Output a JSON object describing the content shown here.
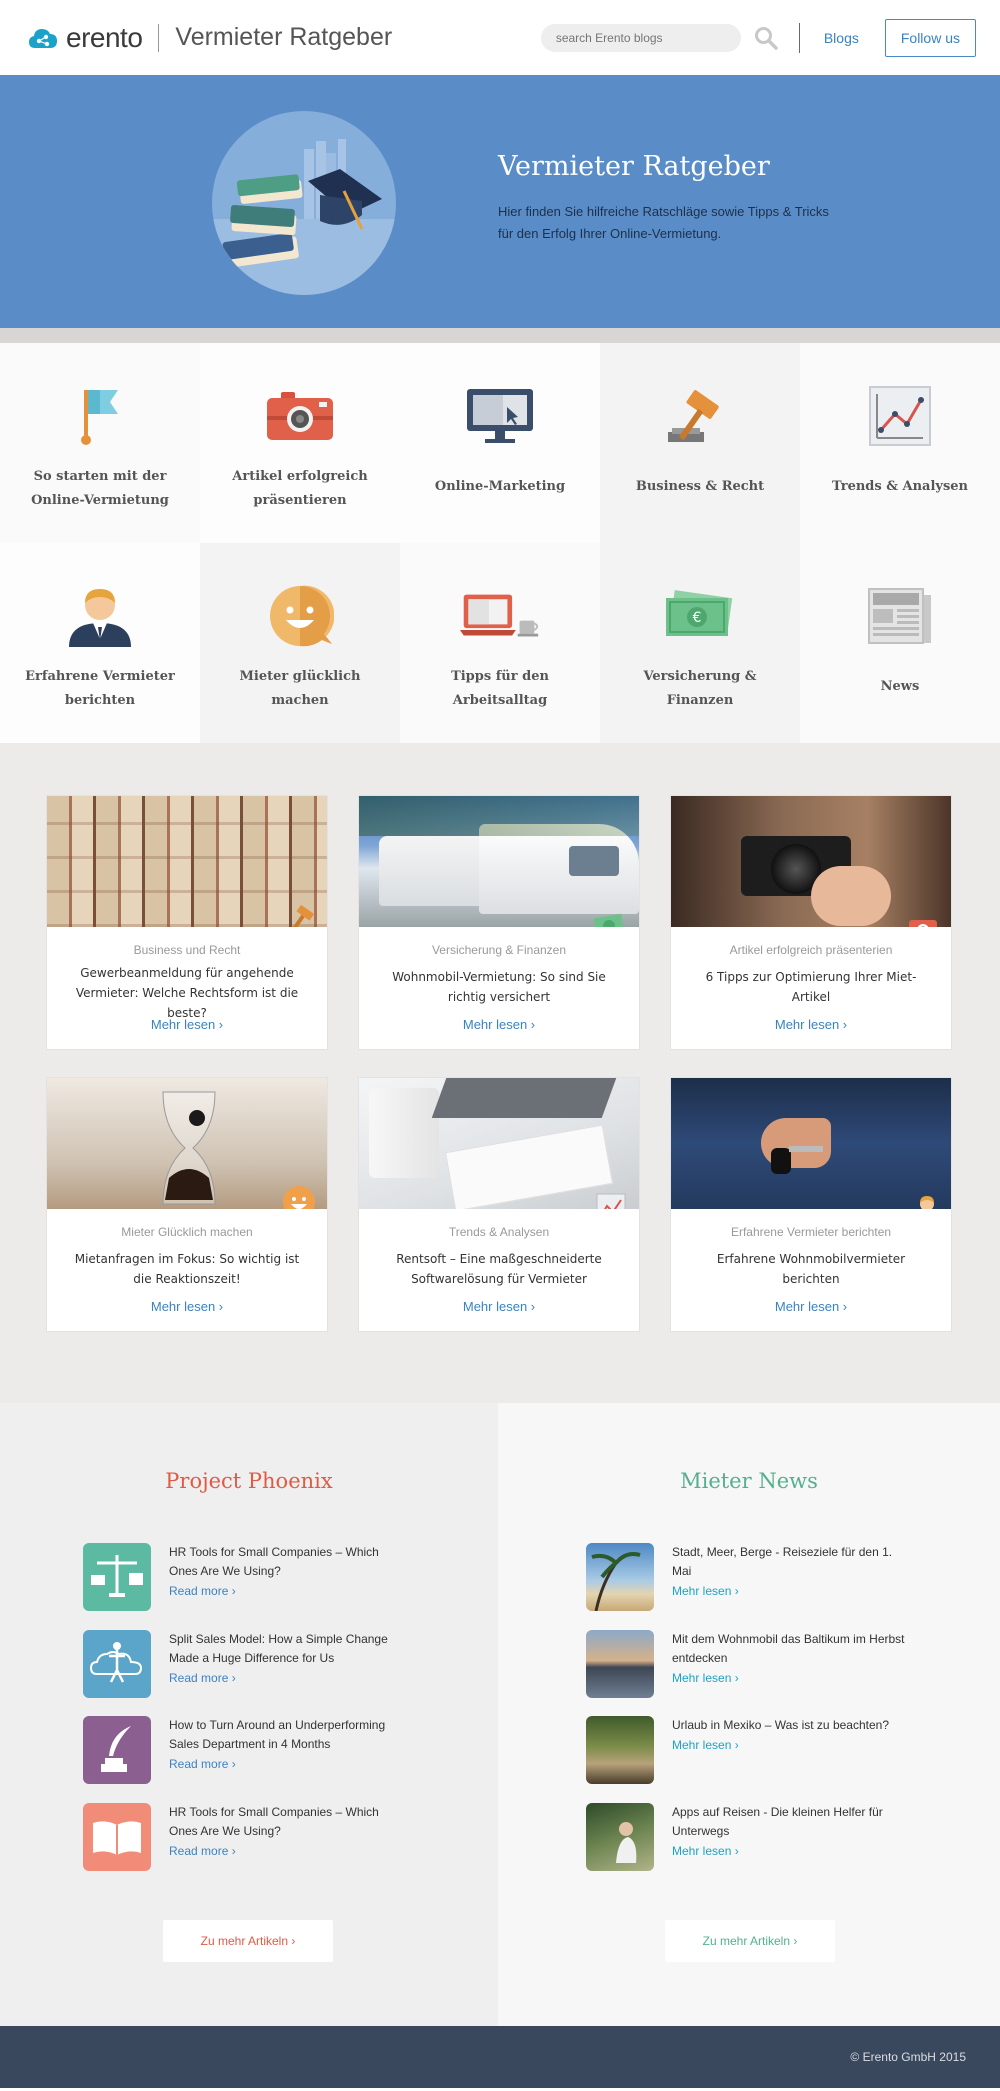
{
  "header": {
    "logo_text": "erento",
    "site_title": "Vermieter Ratgeber",
    "search_placeholder": "search Erento blogs",
    "blogs_label": "Blogs",
    "follow_label": "Follow us"
  },
  "hero": {
    "title": "Vermieter Ratgeber",
    "text": "Hier finden Sie hilfreiche Ratschläge sowie Tipps & Tricks für den Erfolg Ihrer Online-Vermietung."
  },
  "categories": [
    {
      "label": "So starten mit der Online-Vermietung",
      "icon": "flag-icon"
    },
    {
      "label": "Artikel erfolgreich präsentieren",
      "icon": "camera-icon"
    },
    {
      "label": "Online-Marketing",
      "icon": "monitor-icon"
    },
    {
      "label": "Business & Recht",
      "icon": "gavel-icon"
    },
    {
      "label": "Trends & Analysen",
      "icon": "chart-icon"
    },
    {
      "label": "Erfahrene Vermieter berichten",
      "icon": "person-icon"
    },
    {
      "label": "Mieter glücklich machen",
      "icon": "smiley-icon"
    },
    {
      "label": "Tipps für den Arbeitsalltag",
      "icon": "laptop-icon"
    },
    {
      "label": "Versicherung & Finanzen",
      "icon": "money-icon"
    },
    {
      "label": "News",
      "icon": "newspaper-icon"
    }
  ],
  "articles": [
    {
      "category": "Business und Recht",
      "title": "Gewerbeanmeldung für angehende Vermieter: Welche Rechtsform ist die beste?",
      "more": "Mehr lesen ›"
    },
    {
      "category": "Versicherung & Finanzen",
      "title": "Wohnmobil-Vermietung: So sind Sie richtig versichert",
      "more": "Mehr lesen ›"
    },
    {
      "category": "Artikel erfolgreich präsenterien",
      "title": "6 Tipps zur Optimierung Ihrer Miet-Artikel",
      "more": "Mehr lesen ›"
    },
    {
      "category": "Mieter Glücklich machen",
      "title": "Mietanfragen im Fokus: So wichtig ist die Reaktionszeit!",
      "more": "Mehr lesen ›"
    },
    {
      "category": "Trends & Analysen",
      "title": "Rentsoft – Eine maßgeschneiderte Softwarelösung für Vermieter",
      "more": "Mehr lesen ›"
    },
    {
      "category": "Erfahrene Vermieter berichten",
      "title": "Erfahrene Wohnmobilvermieter berichten",
      "more": "Mehr lesen ›"
    }
  ],
  "phoenix": {
    "title": "Project Phoenix",
    "items": [
      {
        "title": "HR Tools for Small Companies – Which Ones Are We Using?",
        "more": "Read more ›"
      },
      {
        "title": "Split Sales Model: How a Simple Change Made a Huge Difference for Us",
        "more": "Read more ›"
      },
      {
        "title": "How to Turn Around an Underperforming Sales Department in 4 Months",
        "more": "Read more ›"
      },
      {
        "title": "HR Tools for Small Companies – Which Ones Are We Using?",
        "more": "Read more ›"
      }
    ],
    "button": "Zu mehr Artikeln ›"
  },
  "mieter": {
    "title": "Mieter News",
    "items": [
      {
        "title": "Stadt, Meer, Berge - Reiseziele für den 1. Mai",
        "more": "Mehr lesen ›"
      },
      {
        "title": "Mit dem Wohnmobil das Baltikum im Herbst entdecken",
        "more": "Mehr lesen ›"
      },
      {
        "title": "Urlaub in Mexiko – Was ist zu beachten?",
        "more": "Mehr lesen ›"
      },
      {
        "title": "Apps auf Reisen - Die kleinen Helfer für Unterwegs",
        "more": "Mehr lesen ›"
      }
    ],
    "button": "Zu mehr Artikeln ›"
  },
  "footer": {
    "copyright": "© Erento GmbH 2015"
  },
  "colors": {
    "accent_blue": "#3a83c3",
    "hero_blue": "#5a8dc8",
    "phoenix_red": "#e05a44",
    "mieter_green": "#53b08f",
    "footer_bg": "#39485d"
  }
}
